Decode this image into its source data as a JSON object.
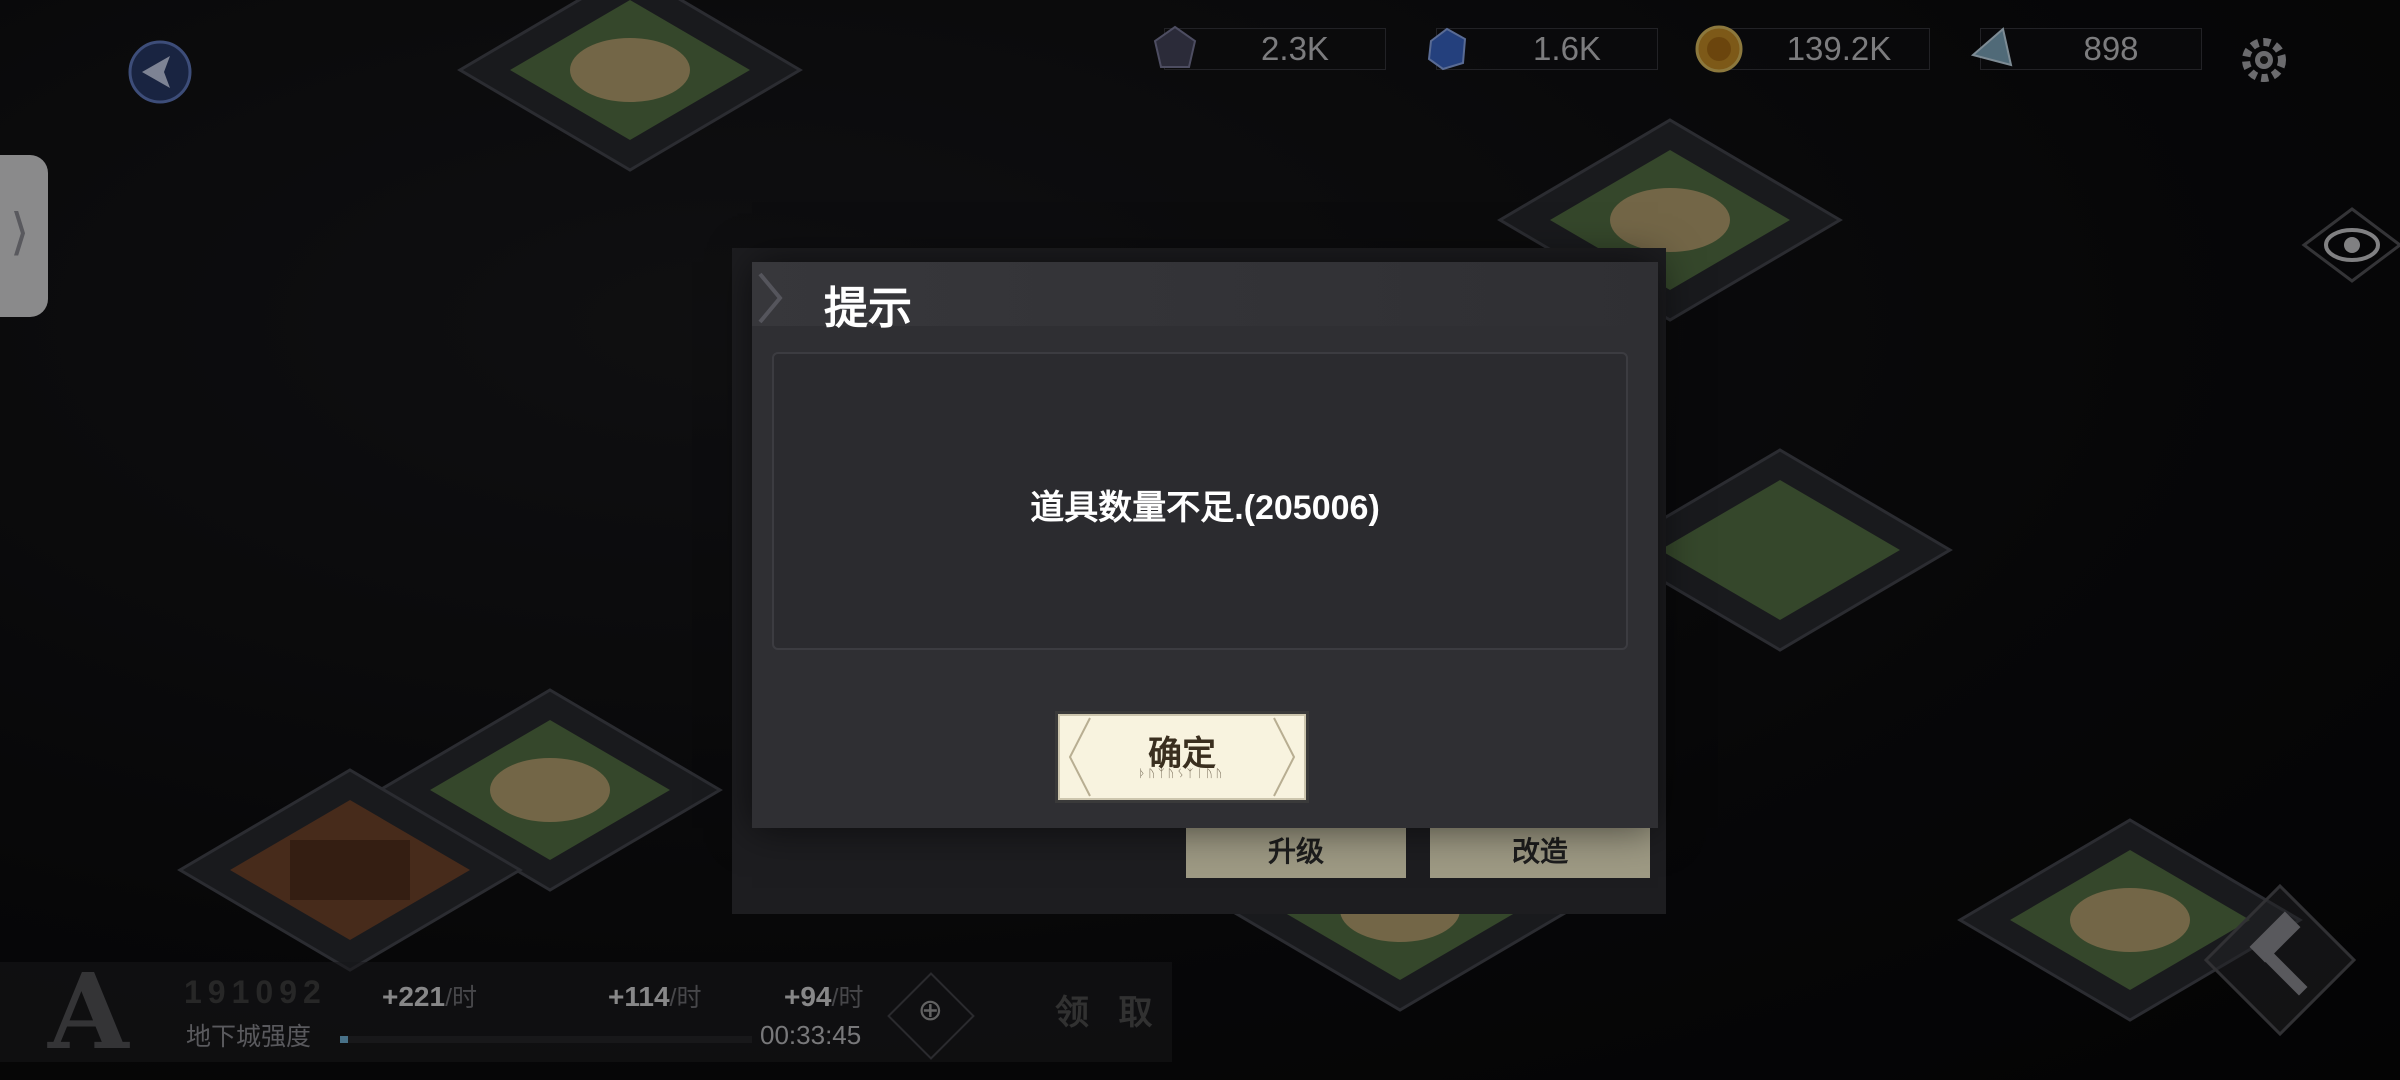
{
  "resources": [
    {
      "icon": "dark-crystal-icon",
      "value": "2.3K",
      "color": "#5a5a78"
    },
    {
      "icon": "blue-ore-icon",
      "value": "1.6K",
      "color": "#3f6fd8"
    },
    {
      "icon": "gold-coin-icon",
      "value": "139.2K",
      "color": "#d79a2a"
    },
    {
      "icon": "crystal-shard-icon",
      "value": "898",
      "color": "#8ab7cf"
    }
  ],
  "bottom": {
    "rank": "A",
    "code": "191092",
    "strength_label": "地下城强度",
    "rates": [
      {
        "value": "+221",
        "unit": "/时"
      },
      {
        "value": "+114",
        "unit": "/时"
      },
      {
        "value": "+94",
        "unit": "/时"
      }
    ],
    "timer": "00:33:45",
    "collect_label": "领 取"
  },
  "under_buttons": {
    "upgrade": "升级",
    "remodel": "改造"
  },
  "dialog": {
    "title": "提示",
    "message": "道具数量不足.(205006)",
    "confirm_label": "确定",
    "confirm_runes": "ᚦᚢᛉᚢᛊᛉᛁᚢᚢ"
  },
  "colors": {
    "accent_button": "#f8f3df",
    "dialog_bg": "#2f2f33"
  }
}
